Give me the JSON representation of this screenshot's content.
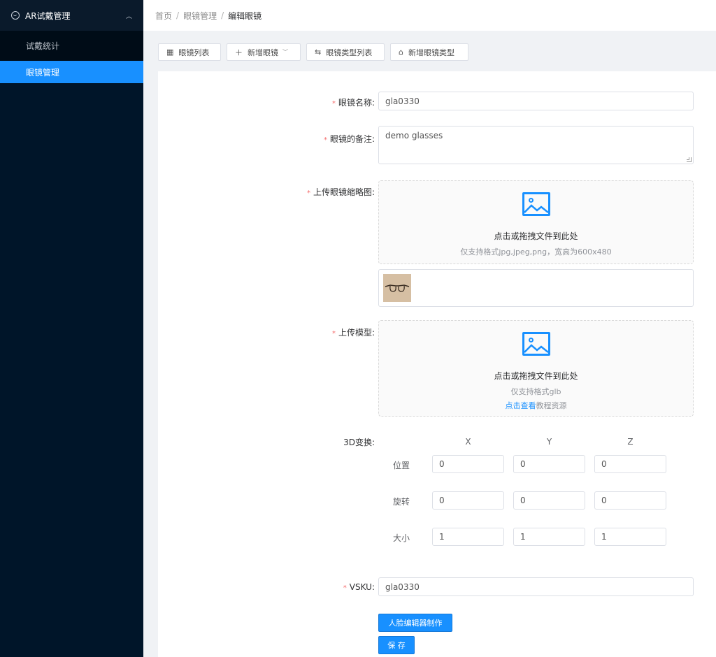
{
  "sidebar": {
    "group_label": "AR试戴管理",
    "items": [
      {
        "label": "试戴统计",
        "active": false
      },
      {
        "label": "眼镜管理",
        "active": true
      }
    ]
  },
  "breadcrumb": [
    "首页",
    "眼镜管理",
    "编辑眼镜"
  ],
  "toolbar": {
    "buttons": [
      {
        "icon": "grid-icon",
        "label": "眼镜列表"
      },
      {
        "icon": "plus-icon",
        "label": "新增眼镜"
      },
      {
        "icon": "swap-icon",
        "label": "眼镜类型列表"
      },
      {
        "icon": "tag-icon",
        "label": "新增眼镜类型"
      }
    ]
  },
  "form": {
    "name": {
      "label": "眼镜名称:",
      "value": "gla0330"
    },
    "note": {
      "label": "眼镜的备注:",
      "value": "demo glasses"
    },
    "thumb_upload": {
      "label": "上传眼镜缩略图:",
      "main": "点击或拖拽文件到此处",
      "hint": "仅支持格式jpg,jpeg,png，宽高为600x480"
    },
    "model_upload": {
      "label": "上传模型:",
      "main": "点击或拖拽文件到此处",
      "hint": "仅支持格式glb",
      "link": "点击查看",
      "link_suffix": "教程资源"
    },
    "transform": {
      "label": "3D变换:",
      "axes": [
        "X",
        "Y",
        "Z"
      ],
      "rows": [
        {
          "label": "位置",
          "values": [
            "0",
            "0",
            "0"
          ]
        },
        {
          "label": "旋转",
          "values": [
            "0",
            "0",
            "0"
          ]
        },
        {
          "label": "大小",
          "values": [
            "1",
            "1",
            "1"
          ]
        }
      ]
    },
    "vsku": {
      "label": "VSKU:",
      "value": "gla0330"
    },
    "face_editor_button": "人脸编辑器制作",
    "save_button": "保 存"
  },
  "colors": {
    "sidebar_bg": "#001529",
    "accent": "#1890ff",
    "required": "#f56c6c"
  }
}
